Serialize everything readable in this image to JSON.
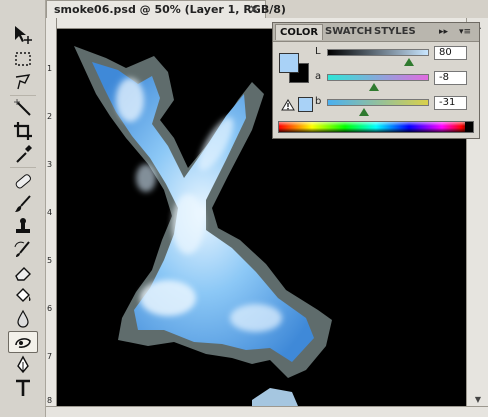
{
  "document": {
    "title": "smoke06.psd @ 50% (Layer 1, RGB/8)",
    "close_glyph": "×",
    "ruler_numbers": [
      "1",
      "2",
      "3",
      "4",
      "5",
      "6",
      "7",
      "8"
    ]
  },
  "tools": [
    {
      "name": "move-tool",
      "icon": "move-arrow-icon"
    },
    {
      "name": "marquee-tool",
      "icon": "marquee-icon"
    },
    {
      "name": "lasso-tool",
      "icon": "lasso-icon"
    },
    {
      "name": "magic-wand-tool",
      "icon": "magic-wand-icon"
    },
    {
      "name": "crop-tool",
      "icon": "crop-icon"
    },
    {
      "name": "eyedropper-tool",
      "icon": "eyedropper-icon"
    },
    {
      "name": "healing-brush-tool",
      "icon": "bandage-icon"
    },
    {
      "name": "brush-tool",
      "icon": "brush-icon"
    },
    {
      "name": "clone-stamp-tool",
      "icon": "stamp-icon"
    },
    {
      "name": "history-brush-tool",
      "icon": "history-brush-icon"
    },
    {
      "name": "eraser-tool",
      "icon": "eraser-icon"
    },
    {
      "name": "paint-bucket-tool",
      "icon": "paint-bucket-icon"
    },
    {
      "name": "blur-tool",
      "icon": "drop-icon"
    },
    {
      "name": "smudge-tool",
      "icon": "smudge-icon",
      "active": true
    },
    {
      "name": "pen-tool",
      "icon": "pen-icon"
    },
    {
      "name": "type-tool",
      "icon": "type-icon"
    }
  ],
  "color_panel": {
    "tabs": [
      "COLOR",
      "SWATCH",
      "STYLES"
    ],
    "active_tab": "COLOR",
    "expand_glyph": "▸▸",
    "menu_glyph": "▾≡",
    "foreground_color": "#a9d2f7",
    "background_color": "#000000",
    "channels": [
      {
        "label": "L",
        "value": "80",
        "thumb": 0.8,
        "gradient": [
          "#000000",
          "#c9e6ff"
        ]
      },
      {
        "label": "a",
        "value": "-8",
        "thumb": 0.46,
        "gradient": [
          "#2ee6d6",
          "#e26be0"
        ]
      },
      {
        "label": "b",
        "value": "-31",
        "thumb": 0.36,
        "gradient": [
          "#4bb0f0",
          "#d9d04a"
        ]
      }
    ],
    "gamut_warning_icon": "warning-triangle-icon",
    "gamut_swatch_color": "#a9d2f7"
  },
  "colors": {
    "canvas_bg": "#000000",
    "smoke_light": "#dff1ff",
    "smoke_mid": "#6cb6f2",
    "smoke_dark": "#3f89d8",
    "smoke_edge": "#9fb4b4"
  }
}
